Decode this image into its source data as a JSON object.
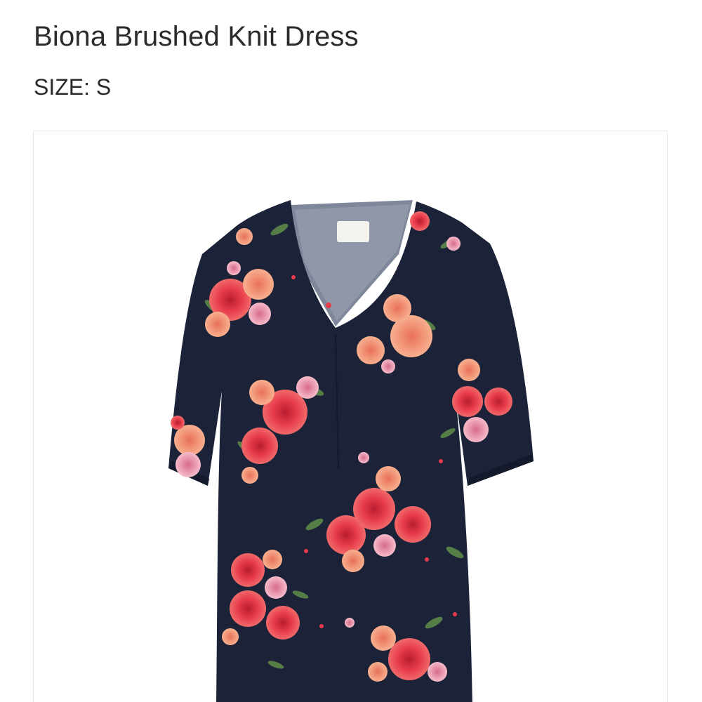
{
  "product": {
    "title": "Biona Brushed Knit Dress",
    "size_label": "SIZE:",
    "size_value": "S"
  },
  "image": {
    "icon": "dress-product-photo",
    "garment_color": "#1c2238",
    "flower_colors": [
      "#e83c4a",
      "#f4907a",
      "#f2a7b8",
      "#5d8a4a"
    ]
  }
}
